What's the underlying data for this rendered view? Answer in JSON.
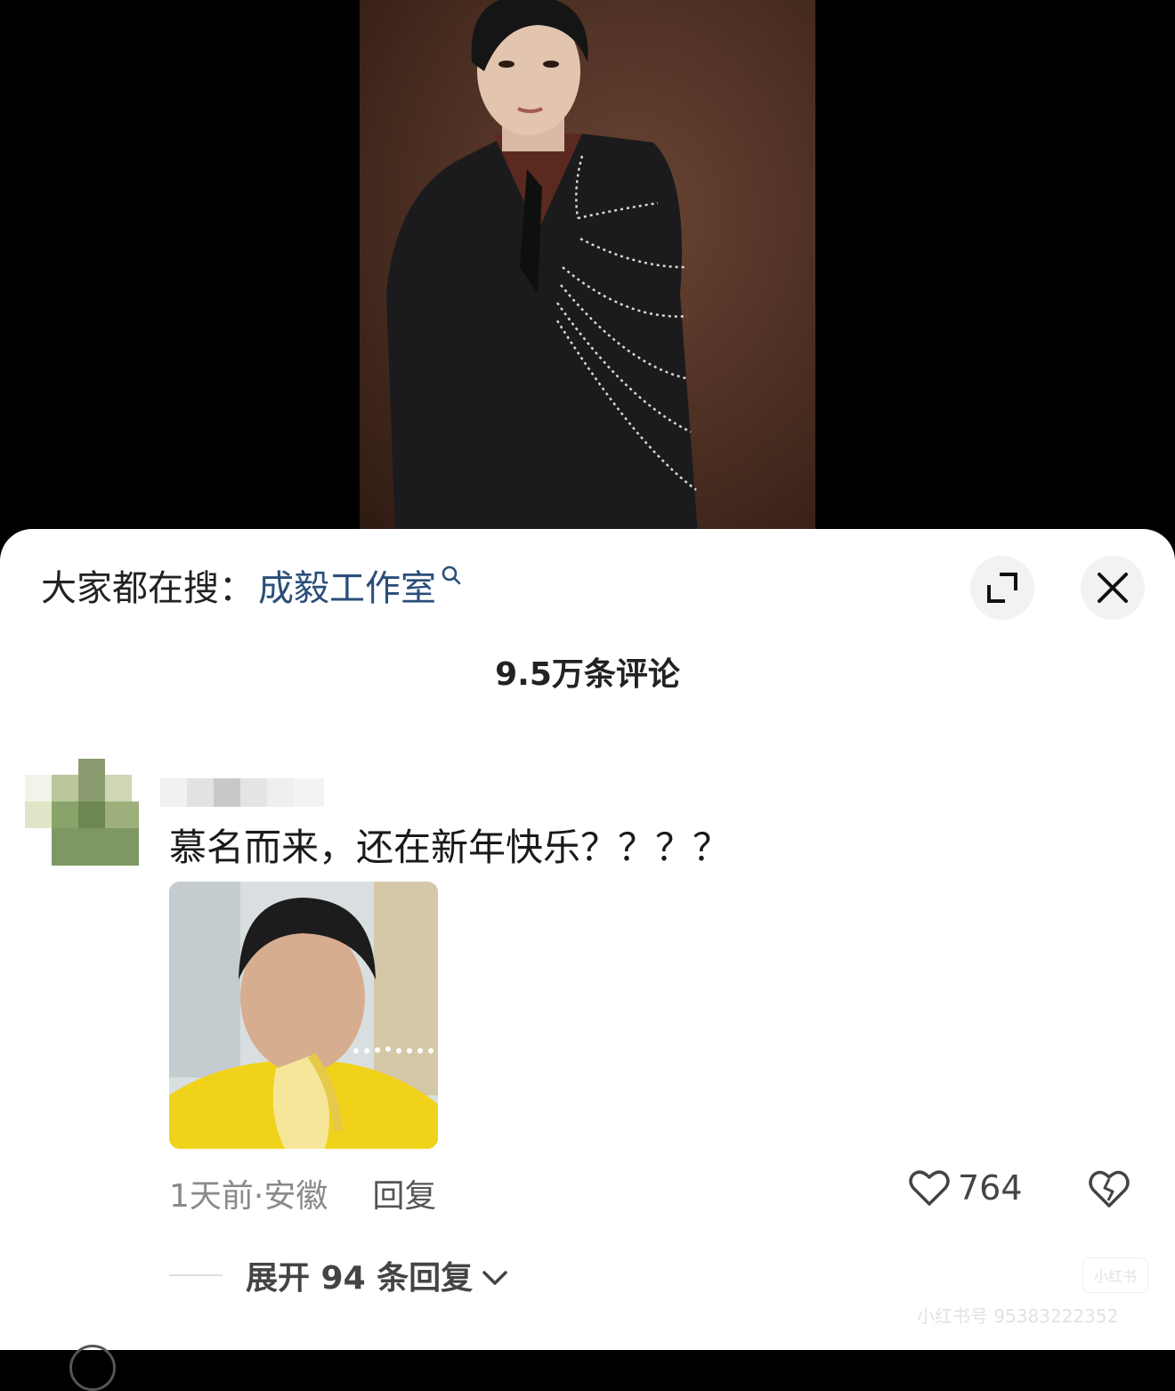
{
  "search_suggestion": {
    "prefix": "大家都在搜：",
    "term": "成毅工作室"
  },
  "comments_header": {
    "count_label": "9.5万条评论"
  },
  "comment": {
    "text": "慕名而来，还在新年快乐？？？？",
    "time_location": "1天前·安徽",
    "reply_label": "回复",
    "like_count": "764",
    "expand_replies_label": "展开 94 条回复"
  },
  "watermark": {
    "badge": "小红书",
    "text": "小红书号 95383222352"
  },
  "colors": {
    "accent_link": "#2a4e79",
    "sheet_bg": "#ffffff",
    "media_bg": "#000000"
  },
  "icons": [
    "search-icon",
    "expand-icon",
    "close-icon",
    "heart-icon",
    "broken-heart-icon",
    "chevron-down-icon"
  ]
}
